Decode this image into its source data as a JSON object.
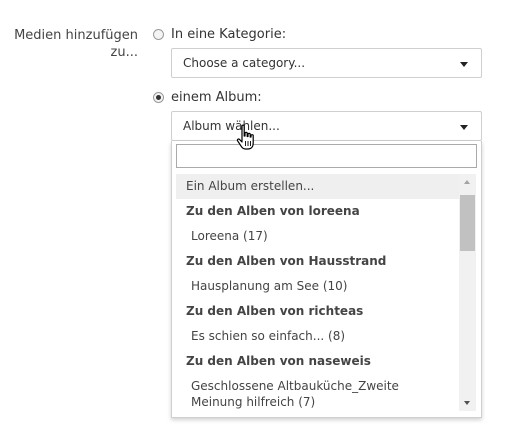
{
  "form": {
    "label": "Medien hinzufügen zu..."
  },
  "option_category": {
    "label": "In eine Kategorie:",
    "selected": false,
    "select_value": "Choose a category..."
  },
  "option_album": {
    "label": "einem Album:",
    "selected": true,
    "select_value": "Album wählen..."
  },
  "dropdown": {
    "search_value": "",
    "items": [
      {
        "label": "Ein Album erstellen...",
        "kind": "highlighted"
      },
      {
        "label": "Zu den Alben von loreena",
        "kind": "group"
      },
      {
        "label": "Loreena (17)",
        "kind": "option"
      },
      {
        "label": "Zu den Alben von Hausstrand",
        "kind": "group"
      },
      {
        "label": "Hausplanung am See (10)",
        "kind": "option"
      },
      {
        "label": "Zu den Alben von richteas",
        "kind": "group"
      },
      {
        "label": "Es schien so einfach... (8)",
        "kind": "option"
      },
      {
        "label": "Zu den Alben von naseweis",
        "kind": "group"
      },
      {
        "label": "Geschlossene Altbauküche_Zweite Meinung hilfreich (7)",
        "kind": "option-multiline"
      }
    ],
    "scrollbar_position": 0.1
  },
  "icons": {
    "cursor": "hand-pointer-icon",
    "caret": "caret-down-icon"
  }
}
